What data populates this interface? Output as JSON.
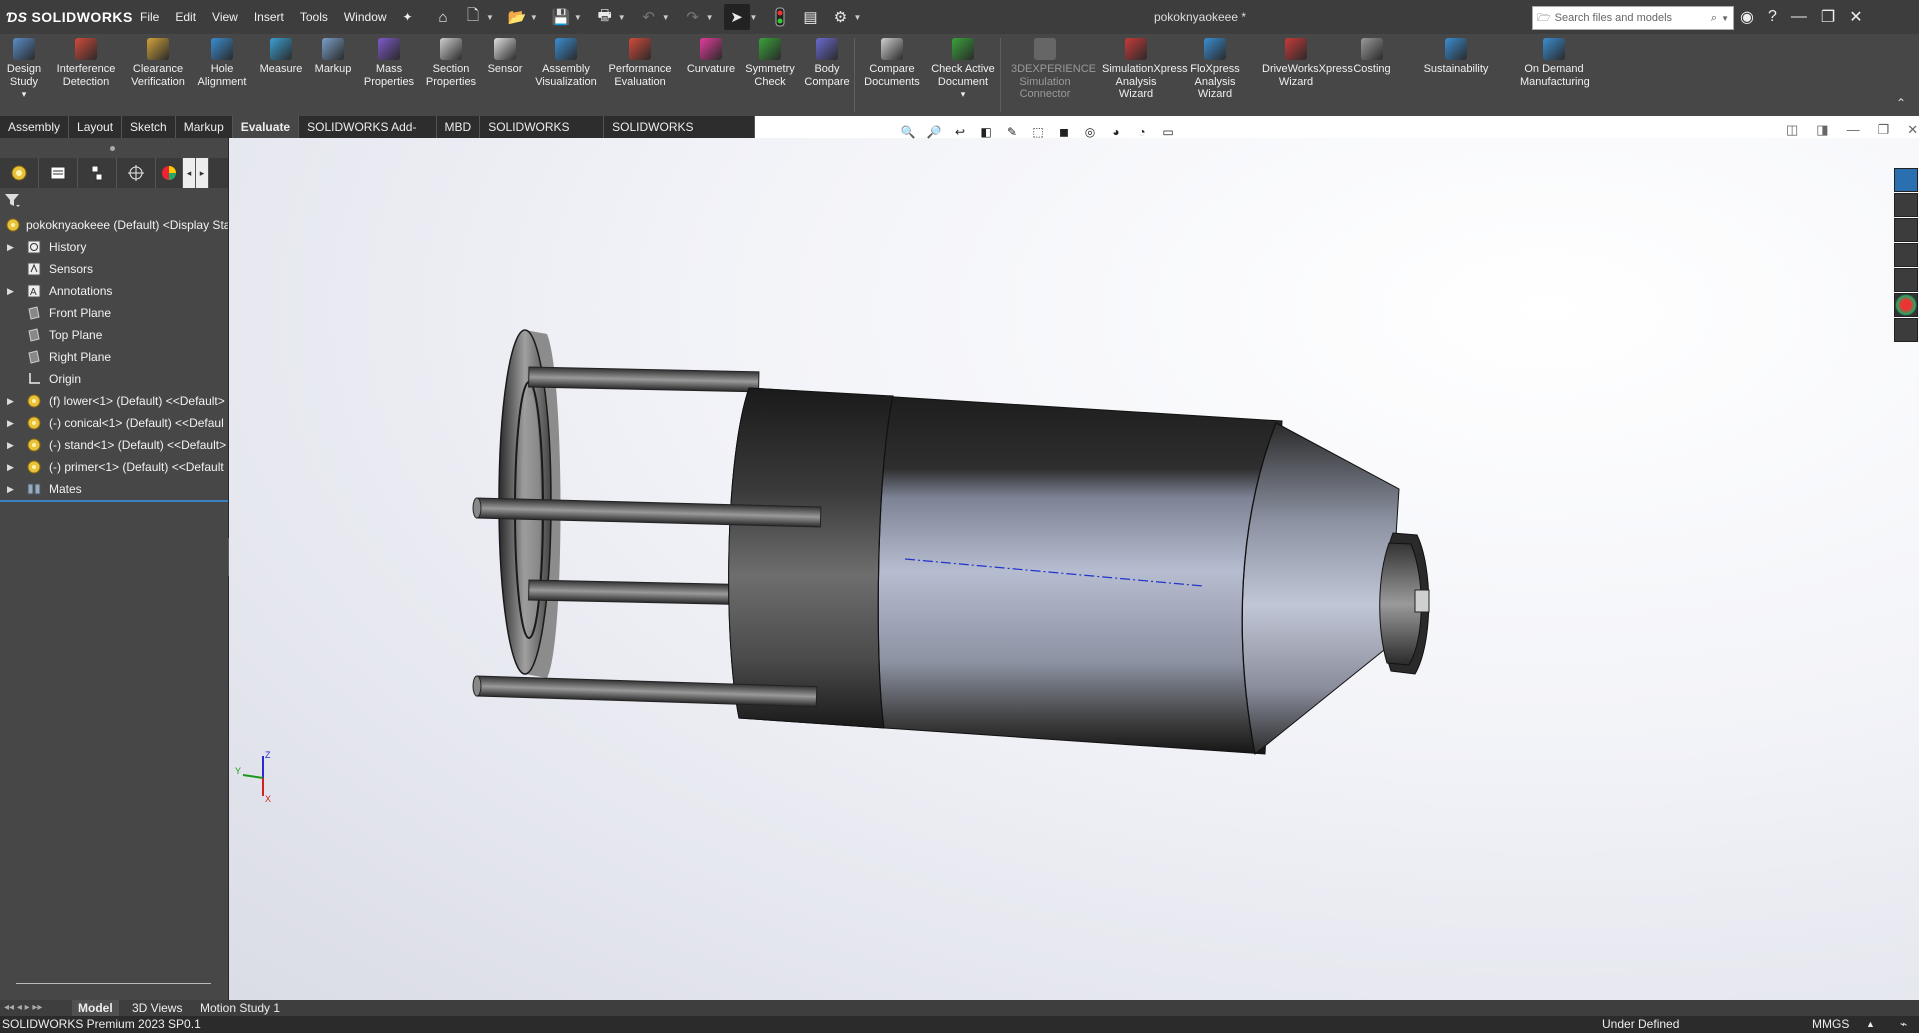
{
  "app": {
    "logo_text": "SOLIDWORKS",
    "document_title": "pokoknyaokeee *",
    "menu": [
      "File",
      "Edit",
      "View",
      "Insert",
      "Tools",
      "Window"
    ],
    "search_placeholder": "Search files and models"
  },
  "command_manager": {
    "buttons": [
      {
        "label": "Design\nStudy",
        "icon": "design-study-icon",
        "enabled": true
      },
      {
        "label": "Interference\nDetection",
        "icon": "interference-detection-icon",
        "enabled": true
      },
      {
        "label": "Clearance\nVerification",
        "icon": "clearance-verification-icon",
        "enabled": true
      },
      {
        "label": "Hole\nAlignment",
        "icon": "hole-alignment-icon",
        "enabled": true
      },
      {
        "label": "Measure",
        "icon": "measure-icon",
        "enabled": true
      },
      {
        "label": "Markup",
        "icon": "markup-icon",
        "enabled": true
      },
      {
        "label": "Mass\nProperties",
        "icon": "mass-properties-icon",
        "enabled": true
      },
      {
        "label": "Section\nProperties",
        "icon": "section-properties-icon",
        "enabled": true
      },
      {
        "label": "Sensor",
        "icon": "sensor-icon",
        "enabled": true
      },
      {
        "label": "Assembly\nVisualization",
        "icon": "assembly-visualization-icon",
        "enabled": true
      },
      {
        "label": "Performance\nEvaluation",
        "icon": "performance-evaluation-icon",
        "enabled": true
      },
      {
        "label": "Curvature",
        "icon": "curvature-icon",
        "enabled": true
      },
      {
        "label": "Symmetry\nCheck",
        "icon": "symmetry-check-icon",
        "enabled": true
      },
      {
        "label": "Body\nCompare",
        "icon": "body-compare-icon",
        "enabled": true
      },
      {
        "label": "Compare\nDocuments",
        "icon": "compare-documents-icon",
        "enabled": true
      },
      {
        "label": "Check Active\nDocument",
        "icon": "check-active-document-icon",
        "enabled": true
      },
      {
        "label": "3DEXPERIENCE\nSimulation\nConnector",
        "icon": "simulation-connector-icon",
        "enabled": false
      },
      {
        "label": "SimulationXpress\nAnalysis Wizard",
        "icon": "simulationxpress-icon",
        "enabled": true
      },
      {
        "label": "FloXpress\nAnalysis\nWizard",
        "icon": "floxpress-icon",
        "enabled": true
      },
      {
        "label": "DriveWorksXpress\nWizard",
        "icon": "driveworksxpress-icon",
        "enabled": true
      },
      {
        "label": "Costing",
        "icon": "costing-icon",
        "enabled": true
      },
      {
        "label": "Sustainability",
        "icon": "sustainability-icon",
        "enabled": true
      },
      {
        "label": "On Demand\nManufacturing",
        "icon": "on-demand-manufacturing-icon",
        "enabled": true
      }
    ]
  },
  "tabs": [
    "Assembly",
    "Layout",
    "Sketch",
    "Markup",
    "Evaluate",
    "SOLIDWORKS Add-Ins",
    "MBD",
    "SOLIDWORKS CAM",
    "SOLIDWORKS Inspection"
  ],
  "active_tab": "Evaluate",
  "feature_tree": {
    "root": "pokoknyaokeee (Default) <Display Sta",
    "items": [
      {
        "label": "History",
        "icon": "history-icon",
        "expandable": true
      },
      {
        "label": "Sensors",
        "icon": "sensors-icon",
        "expandable": false
      },
      {
        "label": "Annotations",
        "icon": "annotations-icon",
        "expandable": true
      },
      {
        "label": "Front Plane",
        "icon": "plane-icon",
        "expandable": false
      },
      {
        "label": "Top Plane",
        "icon": "plane-icon",
        "expandable": false
      },
      {
        "label": "Right Plane",
        "icon": "plane-icon",
        "expandable": false
      },
      {
        "label": "Origin",
        "icon": "origin-icon",
        "expandable": false
      },
      {
        "label": "(f) lower<1> (Default) <<Default>",
        "icon": "part-icon",
        "expandable": true
      },
      {
        "label": "(-) conical<1> (Default) <<Defaul",
        "icon": "part-icon",
        "expandable": true
      },
      {
        "label": "(-) stand<1> (Default) <<Default>",
        "icon": "part-icon",
        "expandable": true
      },
      {
        "label": "(-) primer<1> (Default) <<Default",
        "icon": "part-icon",
        "expandable": true
      },
      {
        "label": "Mates",
        "icon": "mates-icon",
        "expandable": true
      }
    ]
  },
  "bottom_tabs": [
    "Model",
    "3D Views",
    "Motion Study 1"
  ],
  "active_bottom_tab": "Model",
  "status": {
    "product": "SOLIDWORKS Premium 2023 SP0.1",
    "state": "Under Defined",
    "units": "MMGS"
  },
  "colors": {
    "toolbar_bg": "#474747",
    "titlebar_bg": "#3d3d3d",
    "panel_bg": "#474747",
    "selection_blue": "#3b7fc4"
  }
}
